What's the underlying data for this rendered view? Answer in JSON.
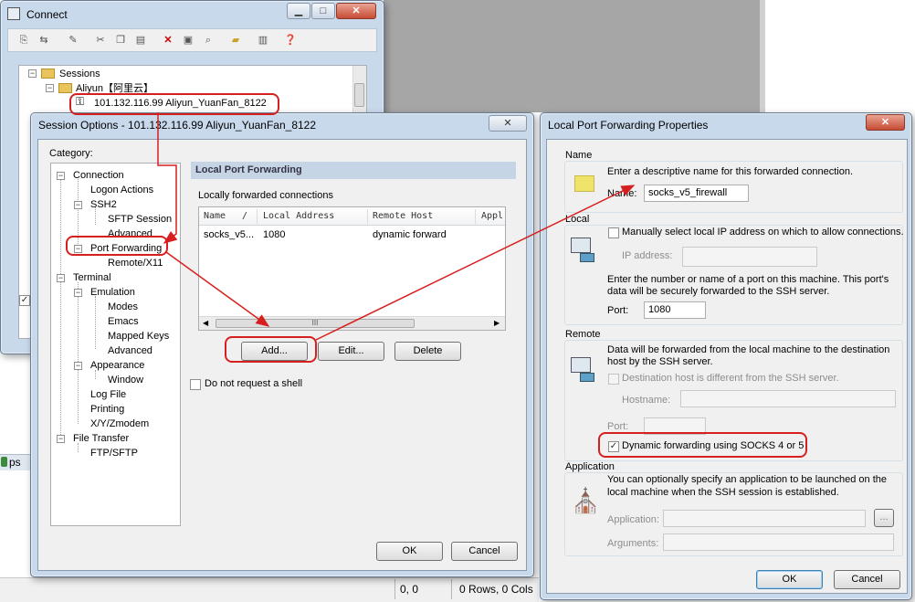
{
  "connect": {
    "title": "Connect",
    "tree": {
      "sessions": "Sessions",
      "aliyun": "Aliyun【阿里云】",
      "session": "101.132.116.99 Aliyun_YuanFan_8122"
    }
  },
  "session_options": {
    "title": "Session Options - 101.132.116.99 Aliyun_YuanFan_8122",
    "category_label": "Category:",
    "categories": [
      "Connection",
      "Logon Actions",
      "SSH2",
      "SFTP Session",
      "Advanced",
      "Port Forwarding",
      "Remote/X11",
      "Terminal",
      "Emulation",
      "Modes",
      "Emacs",
      "Mapped Keys",
      "Advanced",
      "Appearance",
      "Window",
      "Log File",
      "Printing",
      "X/Y/Zmodem",
      "File Transfer",
      "FTP/SFTP"
    ],
    "panel_title": "Local Port Forwarding",
    "connections_label": "Locally forwarded connections",
    "columns": [
      "Name",
      "/",
      "Local Address",
      "Remote Host",
      "Appl"
    ],
    "rows": [
      {
        "name": "socks_v5...",
        "local": "1080",
        "remote": "dynamic forward"
      }
    ],
    "scroll_grip": "III",
    "add": "Add...",
    "edit": "Edit...",
    "delete": "Delete",
    "no_shell": "Do not request a shell",
    "ok": "OK",
    "cancel": "Cancel"
  },
  "lpf": {
    "title": "Local Port Forwarding Properties",
    "name_group": "Name",
    "name_desc": "Enter a descriptive name for this forwarded connection.",
    "name_label": "Name:",
    "name_value": "socks_v5_firewall",
    "local_group": "Local",
    "manual_ip": "Manually select local IP address on which to allow connections.",
    "ip_label": "IP address:",
    "port_desc_1": "Enter the number or name of a port on this machine.  This port's",
    "port_desc_2": "data will be securely forwarded to the SSH server.",
    "port_label": "Port:",
    "port_value": "1080",
    "remote_group": "Remote",
    "remote_desc_1": "Data will be forwarded from the local machine to the destination",
    "remote_desc_2": "host by the SSH server.",
    "dest_diff": "Destination host is different from the SSH server.",
    "hostname_label": "Hostname:",
    "rport_label": "Port:",
    "dynamic": "Dynamic forwarding using SOCKS 4 or 5",
    "app_group": "Application",
    "app_desc_1": "You can optionally specify an application to be launched on the",
    "app_desc_2": "local machine when the SSH session is established.",
    "app_label": "Application:",
    "args_label": "Arguments:",
    "browse": "...",
    "ok": "OK",
    "cancel": "Cancel"
  },
  "statusbar": {
    "pos": "0, 0",
    "size": "0 Rows, 0 Cols"
  },
  "taskbar": {
    "ps": "ps"
  },
  "colors": {
    "annotation": "#d81f1f",
    "title_blue": "#c9d9ec",
    "header_band": "#c6d5e6"
  }
}
